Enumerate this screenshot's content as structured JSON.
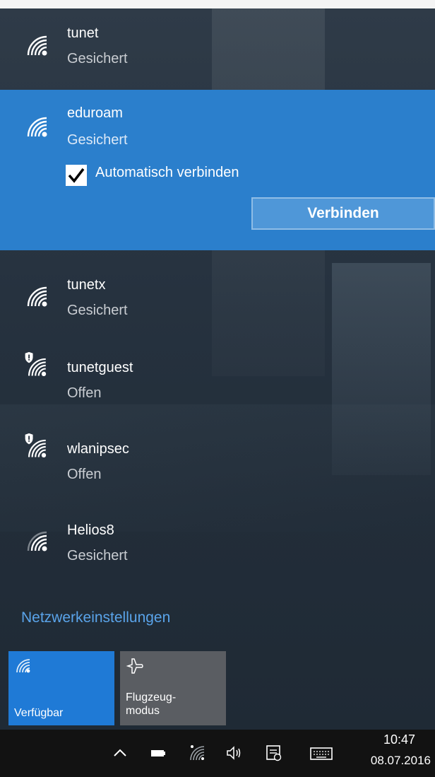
{
  "networks": [
    {
      "name": "tunet",
      "status": "Gesichert",
      "icon": "wifi-secured-icon"
    },
    {
      "name": "eduroam",
      "status": "Gesichert",
      "icon": "wifi-secured-icon",
      "selected": true
    },
    {
      "name": "tunetx",
      "status": "Gesichert",
      "icon": "wifi-secured-icon"
    },
    {
      "name": "tunetguest",
      "status": "Offen",
      "icon": "wifi-open-warning-icon"
    },
    {
      "name": "wlanipsec",
      "status": "Offen",
      "icon": "wifi-open-warning-icon"
    },
    {
      "name": "Helios8",
      "status": "Gesichert",
      "icon": "wifi-secured-icon"
    }
  ],
  "selected_network": {
    "auto_connect_label": "Automatisch verbinden",
    "auto_connect_checked": true,
    "connect_label": "Verbinden"
  },
  "settings_link": "Netzwerkeinstellungen",
  "quick_actions": [
    {
      "label": "Verfügbar",
      "icon": "wifi-icon",
      "active": true
    },
    {
      "label": "Flugzeug-\nmodus",
      "icon": "airplane-icon",
      "active": false
    }
  ],
  "taskbar": {
    "icons": [
      "chevron-up-icon",
      "battery-icon",
      "wifi-icon",
      "volume-icon",
      "action-center-icon",
      "keyboard-icon"
    ],
    "time": "10:47",
    "date": "08.07.2016"
  },
  "colors": {
    "accent": "#2b7fcc",
    "link": "#5aa4ea",
    "tile_active": "#1f7ad6",
    "tile_inactive": "#5a5d62",
    "taskbar": "#121212"
  }
}
